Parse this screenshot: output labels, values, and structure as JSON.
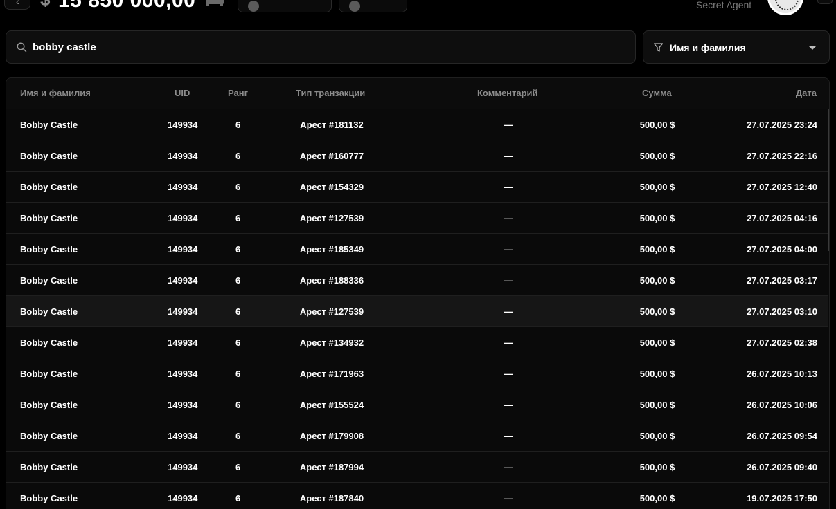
{
  "header": {
    "currency_symbol": "$",
    "balance": "15 850 000,00",
    "agent_title": "Secret Agent",
    "icons": {
      "back": "chevron-left-icon",
      "property": "bed-icon",
      "avatar": "emblem-avatar"
    }
  },
  "search": {
    "value": "bobby castle",
    "icon": "search-icon"
  },
  "filter": {
    "label": "Имя и фамилия",
    "icon": "funnel-icon",
    "caret": "caret-down-icon"
  },
  "table": {
    "columns": {
      "name": "Имя и фамилия",
      "uid": "UID",
      "rank": "Ранг",
      "type": "Тип транзакции",
      "comment": "Комментарий",
      "sum": "Сумма",
      "date": "Дата"
    },
    "rows": [
      {
        "name": "Bobby Castle",
        "uid": "149934",
        "rank": "6",
        "type": "Арест #181132",
        "comment": "—",
        "sum": "500,00 $",
        "date": "27.07.2025 23:24"
      },
      {
        "name": "Bobby Castle",
        "uid": "149934",
        "rank": "6",
        "type": "Арест #160777",
        "comment": "—",
        "sum": "500,00 $",
        "date": "27.07.2025 22:16"
      },
      {
        "name": "Bobby Castle",
        "uid": "149934",
        "rank": "6",
        "type": "Арест #154329",
        "comment": "—",
        "sum": "500,00 $",
        "date": "27.07.2025 12:40"
      },
      {
        "name": "Bobby Castle",
        "uid": "149934",
        "rank": "6",
        "type": "Арест #127539",
        "comment": "—",
        "sum": "500,00 $",
        "date": "27.07.2025 04:16"
      },
      {
        "name": "Bobby Castle",
        "uid": "149934",
        "rank": "6",
        "type": "Арест #185349",
        "comment": "—",
        "sum": "500,00 $",
        "date": "27.07.2025 04:00"
      },
      {
        "name": "Bobby Castle",
        "uid": "149934",
        "rank": "6",
        "type": "Арест #188336",
        "comment": "—",
        "sum": "500,00 $",
        "date": "27.07.2025 03:17"
      },
      {
        "name": "Bobby Castle",
        "uid": "149934",
        "rank": "6",
        "type": "Арест #127539",
        "comment": "—",
        "sum": "500,00 $",
        "date": "27.07.2025 03:10"
      },
      {
        "name": "Bobby Castle",
        "uid": "149934",
        "rank": "6",
        "type": "Арест #134932",
        "comment": "—",
        "sum": "500,00 $",
        "date": "27.07.2025 02:38"
      },
      {
        "name": "Bobby Castle",
        "uid": "149934",
        "rank": "6",
        "type": "Арест #171963",
        "comment": "—",
        "sum": "500,00 $",
        "date": "26.07.2025 10:13"
      },
      {
        "name": "Bobby Castle",
        "uid": "149934",
        "rank": "6",
        "type": "Арест #155524",
        "comment": "—",
        "sum": "500,00 $",
        "date": "26.07.2025 10:06"
      },
      {
        "name": "Bobby Castle",
        "uid": "149934",
        "rank": "6",
        "type": "Арест #179908",
        "comment": "—",
        "sum": "500,00 $",
        "date": "26.07.2025 09:54"
      },
      {
        "name": "Bobby Castle",
        "uid": "149934",
        "rank": "6",
        "type": "Арест #187994",
        "comment": "—",
        "sum": "500,00 $",
        "date": "26.07.2025 09:40"
      },
      {
        "name": "Bobby Castle",
        "uid": "149934",
        "rank": "6",
        "type": "Арест #187840",
        "comment": "—",
        "sum": "500,00 $",
        "date": "19.07.2025 17:50"
      }
    ]
  }
}
